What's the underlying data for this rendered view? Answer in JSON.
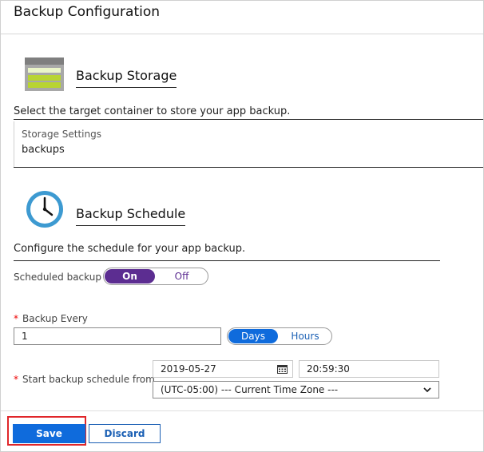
{
  "header": {
    "title": "Backup Configuration"
  },
  "storage": {
    "heading": "Backup Storage",
    "icon": "storage-icon",
    "description": "Select the target container to store your app backup.",
    "settings_label": "Storage Settings",
    "settings_value": "backups"
  },
  "schedule": {
    "heading": "Backup Schedule",
    "icon": "clock-icon",
    "description": "Configure the schedule for your app backup.",
    "scheduled_backup_label": "Scheduled backup",
    "toggle_on": "On",
    "toggle_off": "Off",
    "scheduled_backup_state": "On",
    "backup_every_label": "Backup Every",
    "backup_every_value": "1",
    "unit_days": "Days",
    "unit_hours": "Hours",
    "unit_selected": "Days",
    "start_label": "Start backup schedule from",
    "start_date": "2019-05-27",
    "start_time": "20:59:30",
    "timezone": "(UTC-05:00) --- Current Time Zone ---",
    "required_marker": "*"
  },
  "actions": {
    "save_label": "Save",
    "discard_label": "Discard"
  },
  "colors": {
    "toggle_accent": "#5c2d91",
    "primary_blue": "#0f6bdc",
    "highlight_red": "#e0262a"
  }
}
